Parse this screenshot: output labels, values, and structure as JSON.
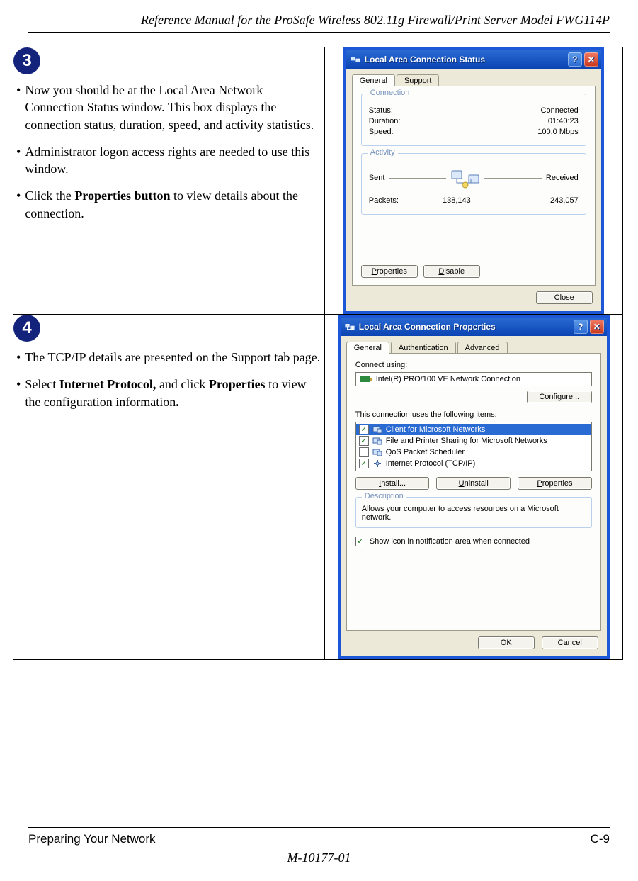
{
  "header": {
    "title": "Reference Manual for the ProSafe Wireless 802.11g  Firewall/Print Server Model FWG114P"
  },
  "steps": {
    "step3": {
      "num": "3",
      "b1": "Now you should be at the Local Area Network Connection Status window. This box displays the connection status, duration, speed, and activity statistics.",
      "b2": "Administrator logon access rights are needed to use this window.",
      "b3a": "Click the ",
      "b3b": "Properties button",
      "b3c": " to view details about the connection."
    },
    "step4": {
      "num": "4",
      "b1": "The TCP/IP details are presented on the Support tab page.",
      "b2a": "Select ",
      "b2b": "Internet Protocol,",
      "b2c": " and click ",
      "b2d": "Properties",
      "b2e": " to view the configuration information",
      "b2f": "."
    }
  },
  "statusWin": {
    "title": "Local Area Connection Status",
    "tabs": {
      "general": "General",
      "support": "Support"
    },
    "connGroup": "Connection",
    "statusL": "Status:",
    "statusV": "Connected",
    "durL": "Duration:",
    "durV": "01:40:23",
    "speedL": "Speed:",
    "speedV": "100.0 Mbps",
    "actGroup": "Activity",
    "sent": "Sent",
    "recv": "Received",
    "packetsL": "Packets:",
    "packetsSent": "138,143",
    "packetsRecv": "243,057",
    "btnProps": "Properties",
    "btnPropsU": "P",
    "btnDisable": "Disable",
    "btnDisableU": "D",
    "btnClose": "Close",
    "btnCloseU": "C"
  },
  "propsWin": {
    "title": "Local Area Connection Properties",
    "tabs": {
      "general": "General",
      "auth": "Authentication",
      "adv": "Advanced"
    },
    "connectUsing": "Connect using:",
    "adapter": "Intel(R) PRO/100 VE Network Connection",
    "btnCfg": "Configure...",
    "btnCfgU": "C",
    "itemsLabel": "This connection uses the following items:",
    "items": [
      {
        "label": "Client for Microsoft Networks",
        "checked": true,
        "selected": true
      },
      {
        "label": "File and Printer Sharing for Microsoft Networks",
        "checked": true,
        "selected": false
      },
      {
        "label": "QoS Packet Scheduler",
        "checked": false,
        "selected": false
      },
      {
        "label": "Internet Protocol (TCP/IP)",
        "checked": true,
        "selected": false
      }
    ],
    "btnInstall": "Install...",
    "btnInstallU": "I",
    "btnUninstall": "Uninstall",
    "btnUninstallU": "U",
    "btnProps": "Properties",
    "btnPropsU": "P",
    "descLabel": "Description",
    "descText": "Allows your computer to access resources on a Microsoft network.",
    "showIcon": "Show icon in notification area when connected",
    "ok": "OK",
    "cancel": "Cancel"
  },
  "footer": {
    "left": "Preparing Your Network",
    "right": "C-9",
    "docnum": "M-10177-01"
  }
}
